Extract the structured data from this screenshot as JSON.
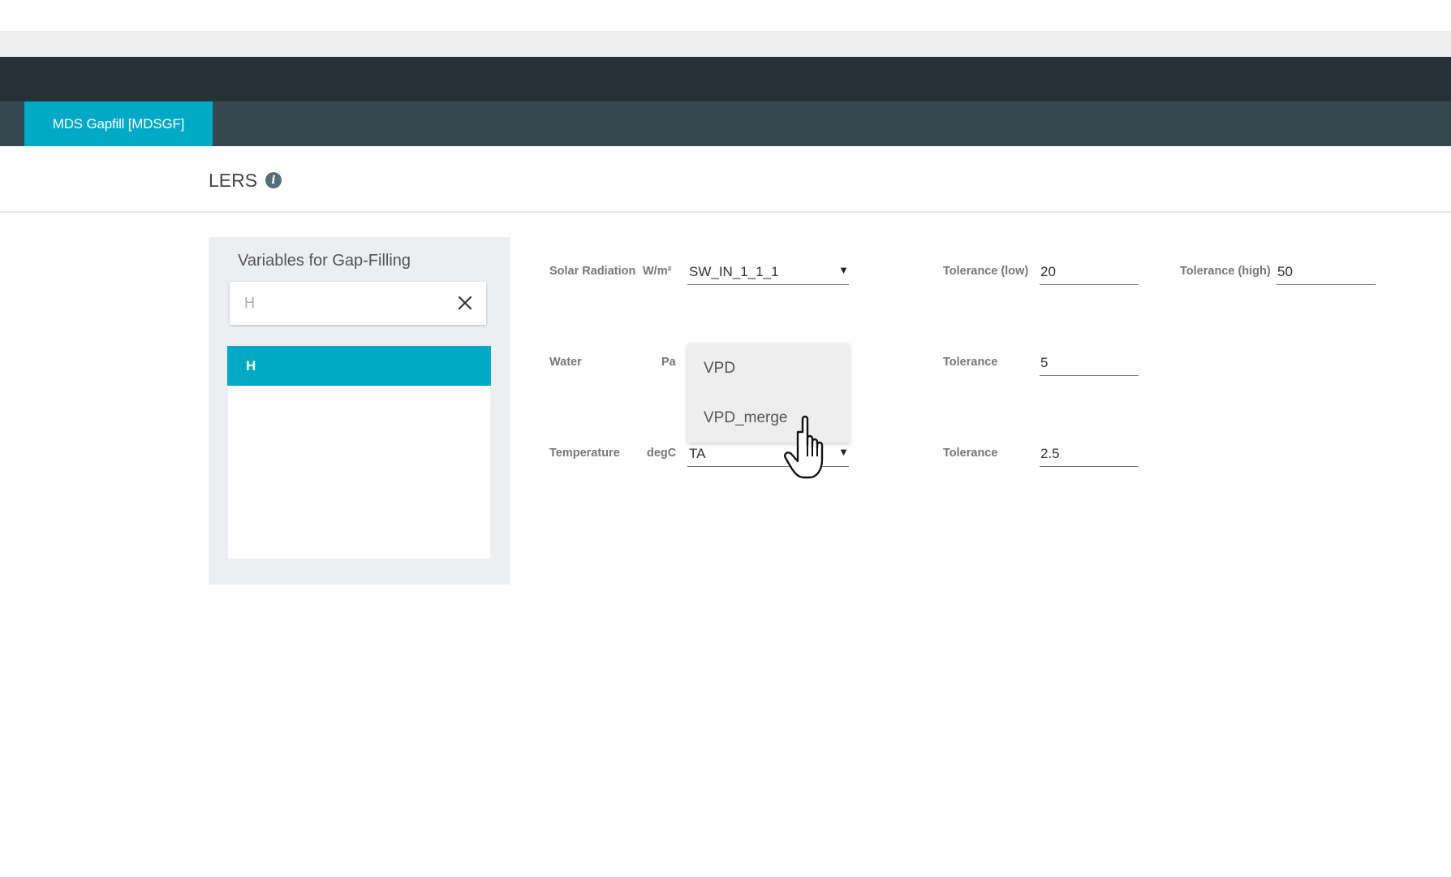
{
  "tabs": {
    "active_label": "MDS Gapfill [MDSGF]"
  },
  "heading": {
    "title": "LERS",
    "info_icon": "info-icon"
  },
  "variables_panel": {
    "title": "Variables for Gap-Filling",
    "search_placeholder": "H",
    "clear_icon": "close-icon",
    "items": [
      {
        "label": "H",
        "selected": true
      }
    ]
  },
  "fields": {
    "solar": {
      "label": "Solar Radiation",
      "unit": "W/m²",
      "value": "SW_IN_1_1_1",
      "tol_low_label": "Tolerance (low)",
      "tol_low": "20",
      "tol_high_label": "Tolerance (high)",
      "tol_high": "50"
    },
    "water": {
      "label": "Water",
      "unit": "Pa",
      "tol_label": "Tolerance",
      "tol": "5"
    },
    "temperature": {
      "label": "Temperature",
      "unit": "degC",
      "value": "TA",
      "tol_label": "Tolerance",
      "tol": "2.5"
    }
  },
  "dropdown": {
    "options": [
      "VPD",
      "VPD_merge"
    ]
  },
  "select_arrow": "▼",
  "colors": {
    "accent": "#00a9c5",
    "header_dark": "#263238",
    "tabbar": "#37474f"
  }
}
